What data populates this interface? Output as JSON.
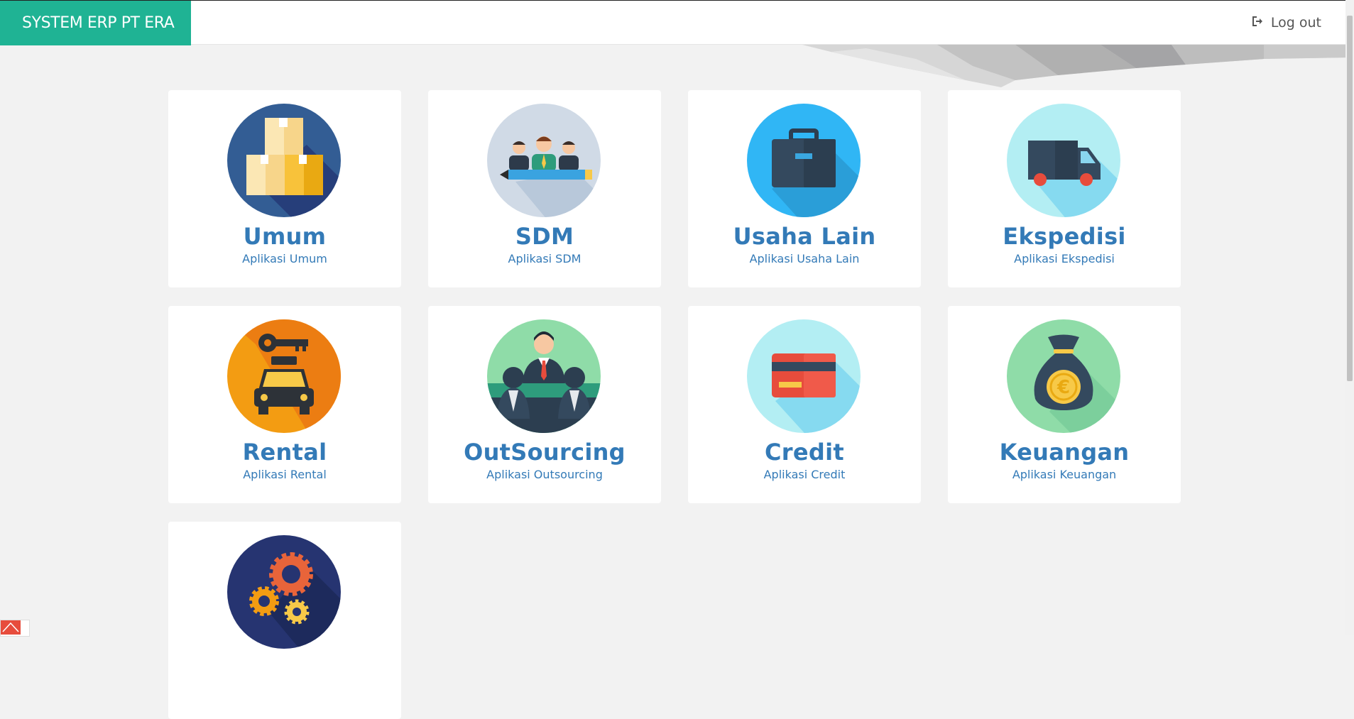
{
  "header": {
    "brand": "SYSTEM ERP PT ERA",
    "logout_label": "Log out",
    "brand_color": "#1fb394",
    "logout_icon": "sign-out-icon"
  },
  "cards": [
    {
      "title": "Umum",
      "subtitle": "Aplikasi Umum",
      "icon": "boxes-icon"
    },
    {
      "title": "SDM",
      "subtitle": "Aplikasi SDM",
      "icon": "team-icon"
    },
    {
      "title": "Usaha Lain",
      "subtitle": "Aplikasi Usaha Lain",
      "icon": "briefcase-icon"
    },
    {
      "title": "Ekspedisi",
      "subtitle": "Aplikasi Ekspedisi",
      "icon": "truck-icon"
    },
    {
      "title": "Rental",
      "subtitle": "Aplikasi Rental",
      "icon": "car-key-icon"
    },
    {
      "title": "OutSourcing",
      "subtitle": "Aplikasi Outsourcing",
      "icon": "meeting-icon"
    },
    {
      "title": "Credit",
      "subtitle": "Aplikasi Credit",
      "icon": "credit-card-icon"
    },
    {
      "title": "Keuangan",
      "subtitle": "Aplikasi Keuangan",
      "icon": "money-bag-icon"
    },
    {
      "title": "",
      "subtitle": "",
      "icon": "gears-icon"
    }
  ],
  "colors": {
    "link": "#337ab7",
    "background": "#f2f2f2"
  }
}
